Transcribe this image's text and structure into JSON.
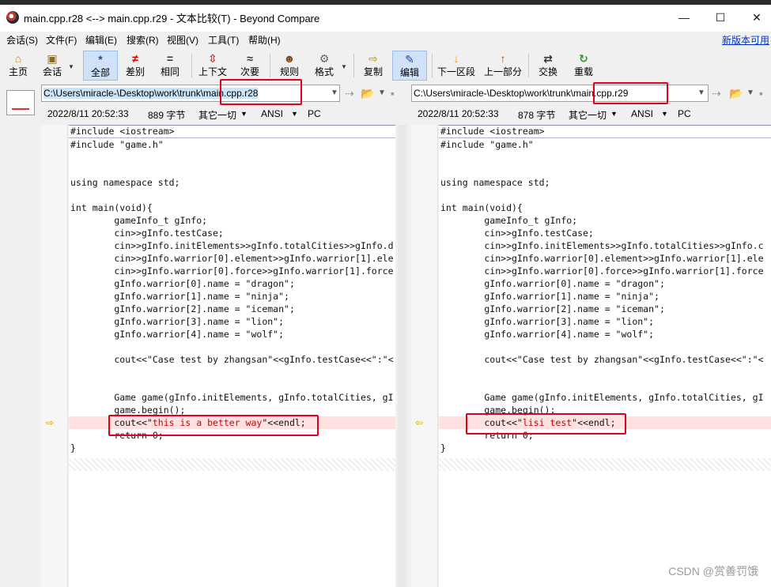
{
  "window": {
    "title": "main.cpp.r28 <--> main.cpp.r29 - 文本比较(T) - Beyond Compare",
    "controls": {
      "minimize": "—",
      "maximize": "☐",
      "close": "✕"
    }
  },
  "menu": {
    "items": [
      "会话(S)",
      "文件(F)",
      "编辑(E)",
      "搜索(R)",
      "视图(V)",
      "工具(T)",
      "帮助(H)"
    ],
    "new_version_link": "新版本可用"
  },
  "toolbar": {
    "buttons": [
      {
        "label": "主页",
        "icon": "⌂"
      },
      {
        "label": "会话",
        "icon": "▣"
      },
      {
        "label": "全部",
        "icon": "*"
      },
      {
        "label": "差别",
        "icon": "≠"
      },
      {
        "label": "相同",
        "icon": "="
      },
      {
        "label": "上下文",
        "icon": "⇳"
      },
      {
        "label": "次要",
        "icon": "≈"
      },
      {
        "label": "规则",
        "icon": "☻"
      },
      {
        "label": "格式",
        "icon": "⚙"
      },
      {
        "label": "复制",
        "icon": "⇨"
      },
      {
        "label": "编辑",
        "icon": "✎"
      },
      {
        "label": "下一区段",
        "icon": "↓"
      },
      {
        "label": "上一部分",
        "icon": "↑"
      },
      {
        "label": "交换",
        "icon": "⇄"
      },
      {
        "label": "重载",
        "icon": "↻"
      }
    ]
  },
  "left": {
    "path_prefix": "C:\\Users\\miracle-\\Desktop\\work\\trunk\\",
    "path_file": "main.cpp.r28",
    "date": "2022/8/11 20:52:33",
    "size": "889 字节",
    "filter": "其它一切",
    "encoding": "ANSI",
    "line_ending": "PC"
  },
  "right": {
    "path_prefix": "C:\\Users\\miracle-\\Desktop\\work\\trunk\\",
    "path_file": "main.cpp.r29",
    "date": "2022/8/11 20:52:33",
    "size": "878 字节",
    "filter": "其它一切",
    "encoding": "ANSI",
    "line_ending": "PC"
  },
  "code_left": [
    "#include <iostream>",
    "#include \"game.h\"",
    "",
    "",
    "using namespace std;",
    "",
    "int main(void){",
    "        gameInfo_t gInfo;",
    "        cin>>gInfo.testCase;",
    "        cin>>gInfo.initElements>>gInfo.totalCities>>gInfo.d",
    "        cin>>gInfo.warrior[0].element>>gInfo.warrior[1].ele",
    "        cin>>gInfo.warrior[0].force>>gInfo.warrior[1].force",
    "        gInfo.warrior[0].name = \"dragon\";",
    "        gInfo.warrior[1].name = \"ninja\";",
    "        gInfo.warrior[2].name = \"iceman\";",
    "        gInfo.warrior[3].name = \"lion\";",
    "        gInfo.warrior[4].name = \"wolf\";",
    "",
    "        cout<<\"Case test by zhangsan\"<<gInfo.testCase<<\":\"<",
    "",
    "",
    "        Game game(gInfo.initElements, gInfo.totalCities, gI",
    "        game.begin();",
    "DIFF",
    "        return 0;",
    "}"
  ],
  "code_right": [
    "#include <iostream>",
    "#include \"game.h\"",
    "",
    "",
    "using namespace std;",
    "",
    "int main(void){",
    "        gameInfo_t gInfo;",
    "        cin>>gInfo.testCase;",
    "        cin>>gInfo.initElements>>gInfo.totalCities>>gInfo.c",
    "        cin>>gInfo.warrior[0].element>>gInfo.warrior[1].ele",
    "        cin>>gInfo.warrior[0].force>>gInfo.warrior[1].force",
    "        gInfo.warrior[0].name = \"dragon\";",
    "        gInfo.warrior[1].name = \"ninja\";",
    "        gInfo.warrior[2].name = \"iceman\";",
    "        gInfo.warrior[3].name = \"lion\";",
    "        gInfo.warrior[4].name = \"wolf\";",
    "",
    "        cout<<\"Case test by zhangsan\"<<gInfo.testCase<<\":\"<",
    "",
    "",
    "        Game game(gInfo.initElements, gInfo.totalCities, gI",
    "        game.begin();",
    "DIFF",
    "        return 0;",
    "}"
  ],
  "diff_left": {
    "prefix": "        cout<<\"",
    "changed": "this is a better way",
    "suffix": "\"<<endl;"
  },
  "diff_right": {
    "prefix": "        cout<<\"",
    "changed": "lisi test",
    "suffix": "\"<<endl;"
  },
  "watermark": "CSDN @赏善罚饿",
  "colors": {
    "diff_line_bg": "#ffe1e1",
    "diff_text": "#d00000",
    "highlight_box": "#e3001b"
  }
}
